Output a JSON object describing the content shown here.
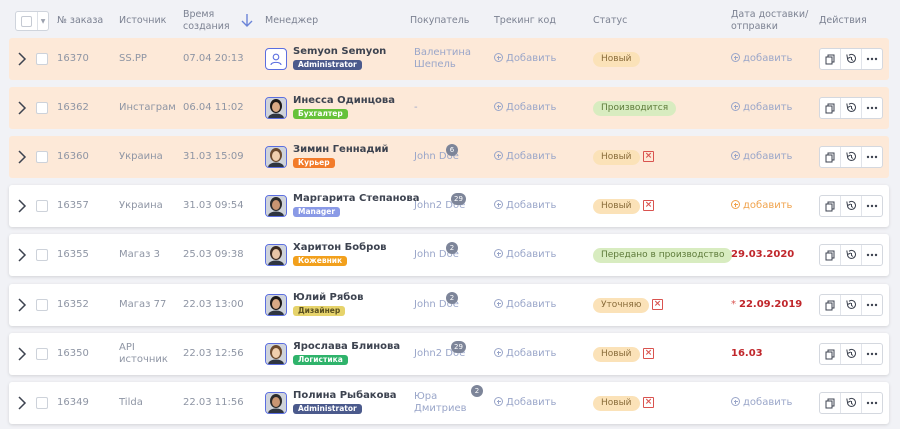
{
  "header": {
    "order_no": "№ заказа",
    "source": "Источник",
    "created": "Время создания",
    "manager": "Менеджер",
    "buyer": "Покупатель",
    "tracking": "Трекинг код",
    "status": "Статус",
    "delivery": "Дата доставки/ отправки",
    "actions": "Действия"
  },
  "orders": [
    {
      "id": "16370",
      "source": "SS.PP",
      "created": "07.04 20:13",
      "manager": "Semyon Semyon",
      "role": "Administrator",
      "role_color": "#4b5a8c",
      "buyer": "Валентина Шепель",
      "count": "",
      "track": "Добавить",
      "status": "Новый",
      "status_kind": "yellow",
      "delete": false,
      "delivery": "добавить",
      "delivery_kind": "link",
      "highlight": true,
      "avatar": "user-outline"
    },
    {
      "id": "16362",
      "source": "Инстаграм",
      "created": "06.04 11:02",
      "manager": "Инесса Одинцова",
      "role": "Бухгалтер",
      "role_color": "#66c23a",
      "buyer": "-",
      "count": "",
      "track": "Добавить",
      "status": "Производится",
      "status_kind": "green",
      "delete": false,
      "delivery": "добавить",
      "delivery_kind": "link",
      "highlight": true,
      "avatar": "photo"
    },
    {
      "id": "16360",
      "source": "Украина",
      "created": "31.03 15:09",
      "manager": "Зимин Геннадий",
      "role": "Курьер",
      "role_color": "#f27b2a",
      "buyer": "John Doe",
      "count": "6",
      "track": "Добавить",
      "status": "Новый",
      "status_kind": "yellow",
      "delete": true,
      "delivery": "добавить",
      "delivery_kind": "link",
      "highlight": true,
      "avatar": "photo"
    },
    {
      "id": "16357",
      "source": "Украина",
      "created": "31.03 09:54",
      "manager": "Маргарита Степанова",
      "role": "Manager",
      "role_color": "#8a9ae6",
      "buyer": "John2 Doe",
      "count": "29",
      "track": "Добавить",
      "status": "Новый",
      "status_kind": "yellow",
      "delete": true,
      "delivery": "добавить",
      "delivery_kind": "orange",
      "highlight": false,
      "avatar": "photo"
    },
    {
      "id": "16355",
      "source": "Магаз 3",
      "created": "25.03 09:38",
      "manager": "Харитон Бобров",
      "role": "Кожевник",
      "role_color": "#f2a01c",
      "buyer": "John Doe",
      "count": "2",
      "track": "Добавить",
      "status": "Передано в производство",
      "status_kind": "green",
      "delete": false,
      "delivery": "29.03.2020",
      "delivery_kind": "date",
      "highlight": false,
      "avatar": "photo"
    },
    {
      "id": "16352",
      "source": "Магаз 77",
      "created": "22.03 13:00",
      "manager": "Юлий Рябов",
      "role": "Дизайнер",
      "role_color": "#e6d36b",
      "buyer": "John Doe",
      "count": "2",
      "track": "Добавить",
      "status": "Уточняю",
      "status_kind": "yellow",
      "delete": true,
      "delivery": "22.09.2019",
      "delivery_kind": "date-ast",
      "highlight": false,
      "avatar": "photo"
    },
    {
      "id": "16350",
      "source": "API источник",
      "created": "22.03 12:56",
      "manager": "Ярослава Блинова",
      "role": "Логистика",
      "role_color": "#2fb36b",
      "buyer": "John2 Doe",
      "count": "29",
      "track": "Добавить",
      "status": "Новый",
      "status_kind": "yellow",
      "delete": true,
      "delivery": "16.03",
      "delivery_kind": "date",
      "highlight": false,
      "avatar": "photo"
    },
    {
      "id": "16349",
      "source": "Tilda",
      "created": "22.03 11:56",
      "manager": "Полина Рыбакова",
      "role": "Administrator",
      "role_color": "#4b5a8c",
      "buyer": "Юра Дмитриев",
      "count": "2",
      "track": "Добавить",
      "status": "Новый",
      "status_kind": "yellow",
      "delete": true,
      "delivery": "добавить",
      "delivery_kind": "link",
      "highlight": false,
      "avatar": "photo"
    }
  ],
  "icons": {
    "chevron": "chevron-right-icon",
    "copy": "copy-icon",
    "history": "history-icon",
    "more": "more-icon",
    "delete": "delete-icon",
    "sort": "arrow-down-icon"
  }
}
